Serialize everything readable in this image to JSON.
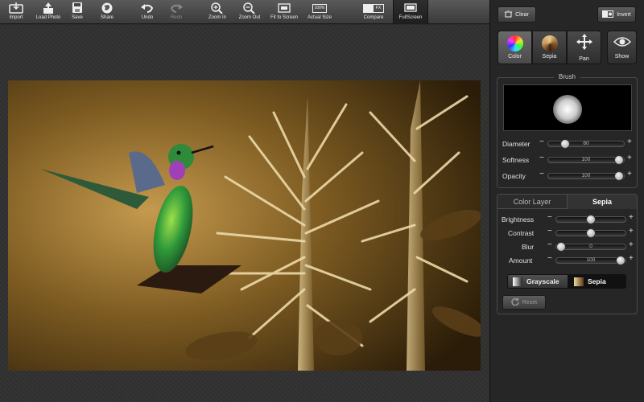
{
  "toolbar": {
    "import": "Import",
    "load_photo": "Load Photo",
    "save": "Save",
    "share": "Share",
    "undo": "Undo",
    "redo": "Redo",
    "zoom_in": "Zoom In",
    "zoom_out": "Zoom Out",
    "fit_to_screen": "Fit to Screen",
    "actual_size": "Actual Size",
    "actual_size_badge": "100%",
    "compare": "Compare",
    "compare_badge": "FX",
    "fullscreen": "FullScreen"
  },
  "panel": {
    "clear": "Clear",
    "invert": "Invert",
    "modes": {
      "color": "Color",
      "sepia": "Sepia",
      "pan": "Pan",
      "show": "Show"
    },
    "brush": {
      "title": "Brush",
      "diameter": {
        "label": "Diameter",
        "value": "60",
        "fraction": 0.18
      },
      "softness": {
        "label": "Softness",
        "value": "100",
        "fraction": 1.0
      },
      "opacity": {
        "label": "Opacity",
        "value": "100",
        "fraction": 1.0
      }
    },
    "layers": {
      "tab_color": "Color Layer",
      "tab_sepia": "Sepia",
      "brightness": {
        "label": "Brightness",
        "fraction": 0.5
      },
      "contrast": {
        "label": "Contrast",
        "fraction": 0.5
      },
      "blur": {
        "label": "Blur",
        "value": "0",
        "fraction": 0.0
      },
      "amount": {
        "label": "Amount",
        "value": "100",
        "fraction": 1.0
      },
      "grayscale": "Grayscale",
      "sepia_btn": "Sepia",
      "reset": "Reset"
    }
  },
  "minus": "−",
  "plus": "+"
}
